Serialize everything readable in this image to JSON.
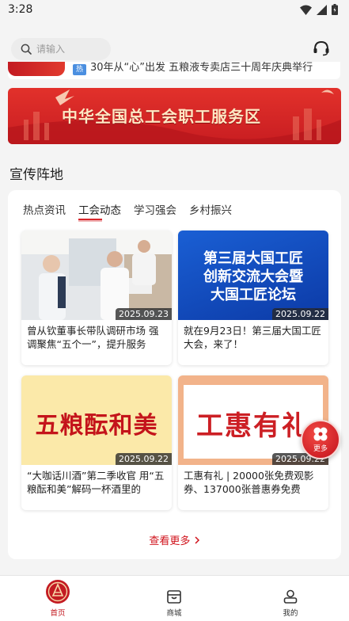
{
  "status_bar": {
    "time": "3:28"
  },
  "search": {
    "placeholder": "请输入"
  },
  "news_ticker": {
    "tag": "热",
    "text": "30年从“心”出发 五粮液专卖店三十周年庆典举行"
  },
  "banner": {
    "title": "中华全国总工会职工服务区"
  },
  "section": {
    "title": "宣传阵地"
  },
  "tabs": [
    {
      "label": "热点资讯",
      "active": false
    },
    {
      "label": "工会动态",
      "active": true
    },
    {
      "label": "学习强会",
      "active": false
    },
    {
      "label": "乡村振兴",
      "active": false
    }
  ],
  "articles": [
    {
      "date": "2025.09.23",
      "caption": "曾从钦董事长带队调研市场 强调聚焦“五个一”，提升服务",
      "image_text": ""
    },
    {
      "date": "2025.09.22",
      "caption": "就在9月23日！第三届大国工匠大会，来了！",
      "image_text": "第三届大国工匠 创新交流大会暨 大国工匠论坛",
      "image_lines": [
        "第三届大国工匠",
        "创新交流大会暨",
        "大国工匠论坛"
      ]
    },
    {
      "date": "2025.09.22",
      "caption": "“大咖话川酒”第二季收官 用“五粮酝和美”解码一杯酒里的",
      "image_text": "五粮酝和美"
    },
    {
      "date": "2025.09.22",
      "caption": "工惠有礼 | 20000张免费观影券、137000张普惠券免费",
      "image_text": "工惠有礼"
    }
  ],
  "more_link": {
    "label": "查看更多"
  },
  "float_button": {
    "label": "更多"
  },
  "tabbar": [
    {
      "label": "首页",
      "icon": "home-emblem-icon",
      "active": true
    },
    {
      "label": "商城",
      "icon": "store-icon",
      "active": false
    },
    {
      "label": "我的",
      "icon": "profile-icon",
      "active": false
    }
  ],
  "colors": {
    "accent": "#c31b22",
    "banner_red": "#d9262c",
    "tag_blue": "#4b8fe0"
  }
}
